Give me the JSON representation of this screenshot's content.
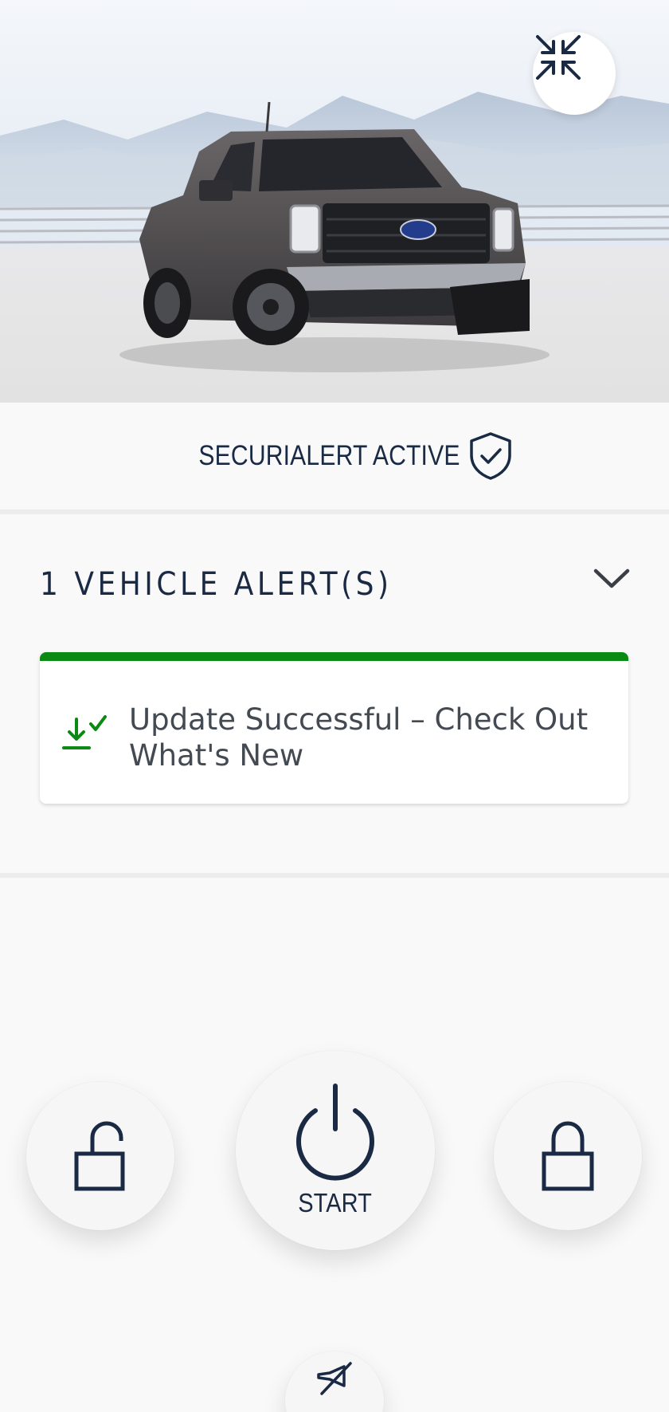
{
  "hero": {
    "collapse_icon": "collapse-arrows-icon",
    "vehicle_image": "pickup-truck-image"
  },
  "security": {
    "label": "SECURIALERT ACTIVE",
    "icon": "shield-check-icon"
  },
  "alerts": {
    "title": "1 VEHICLE ALERT(S)",
    "expand_icon": "chevron-down-icon",
    "items": [
      {
        "text": "Update Successful – Check Out What's New",
        "icon": "download-check-icon",
        "status_color": "#0a8a12"
      }
    ]
  },
  "controls": {
    "unlock_icon": "unlock-icon",
    "start_label": "START",
    "start_icon": "power-icon",
    "lock_icon": "lock-icon",
    "horn_icon": "horn-off-icon"
  },
  "colors": {
    "navy": "#1b2a44",
    "success_green": "#0a8a12",
    "background": "#f9f9f9"
  }
}
